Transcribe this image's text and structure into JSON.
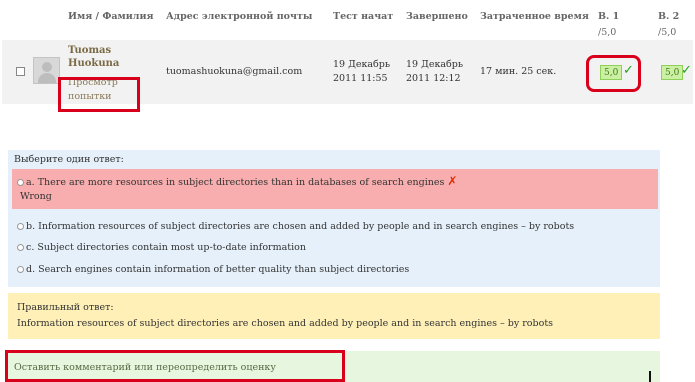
{
  "table": {
    "headers": {
      "name": "Имя / Фамилия",
      "email": "Адрес электронной почты",
      "started": "Тест начат",
      "completed": "Завершено",
      "time_taken": "Затраченное время",
      "q1": "В. 1",
      "q1_max": "/5,0",
      "q2": "В. 2",
      "q2_max": "/5,0"
    },
    "row": {
      "first_name": "Tuomas",
      "last_name": "Huokuna",
      "review_link_1": "Просмотр",
      "review_link_2": "попытки",
      "email": "tuomashuokuna@gmail.com",
      "started_date": "19 Декабрь",
      "started_time": "2011 11:55",
      "completed_date": "19 Декабрь",
      "completed_time": "2011 12:12",
      "time_taken": "17 мин. 25 сек.",
      "q1_grade": "5,0",
      "q2_grade": "5,0"
    }
  },
  "question": {
    "prompt": "Выберите один ответ:",
    "options": [
      {
        "text": "a. There are more resources in subject directories than in databases of search engines"
      },
      {
        "text": "b.  Information resources of subject directories are chosen and added by people and in search engines – by robots"
      },
      {
        "text": "c. Subject directories contain most up-to-date information"
      },
      {
        "text": "d. Search engines contain information of better quality than subject directories"
      }
    ],
    "feedback": "Wrong",
    "correct_label": "Правильный ответ:",
    "correct_text": "Information resources of subject directories are chosen and added by people and in search engines – by robots",
    "comment_link": "Оставить комментарий или переопределить оценку"
  },
  "colors": {
    "highlight": "#d8001a",
    "wrong_bg": "#f8aeae",
    "question_bg": "#e5f0fa",
    "correct_bg": "#fff0b8",
    "comment_bg": "#e7f6de",
    "grade_bg": "#c9f0a3"
  },
  "icons": {
    "check": "check-icon",
    "cross": "cross-icon",
    "avatar": "user-avatar-icon"
  }
}
